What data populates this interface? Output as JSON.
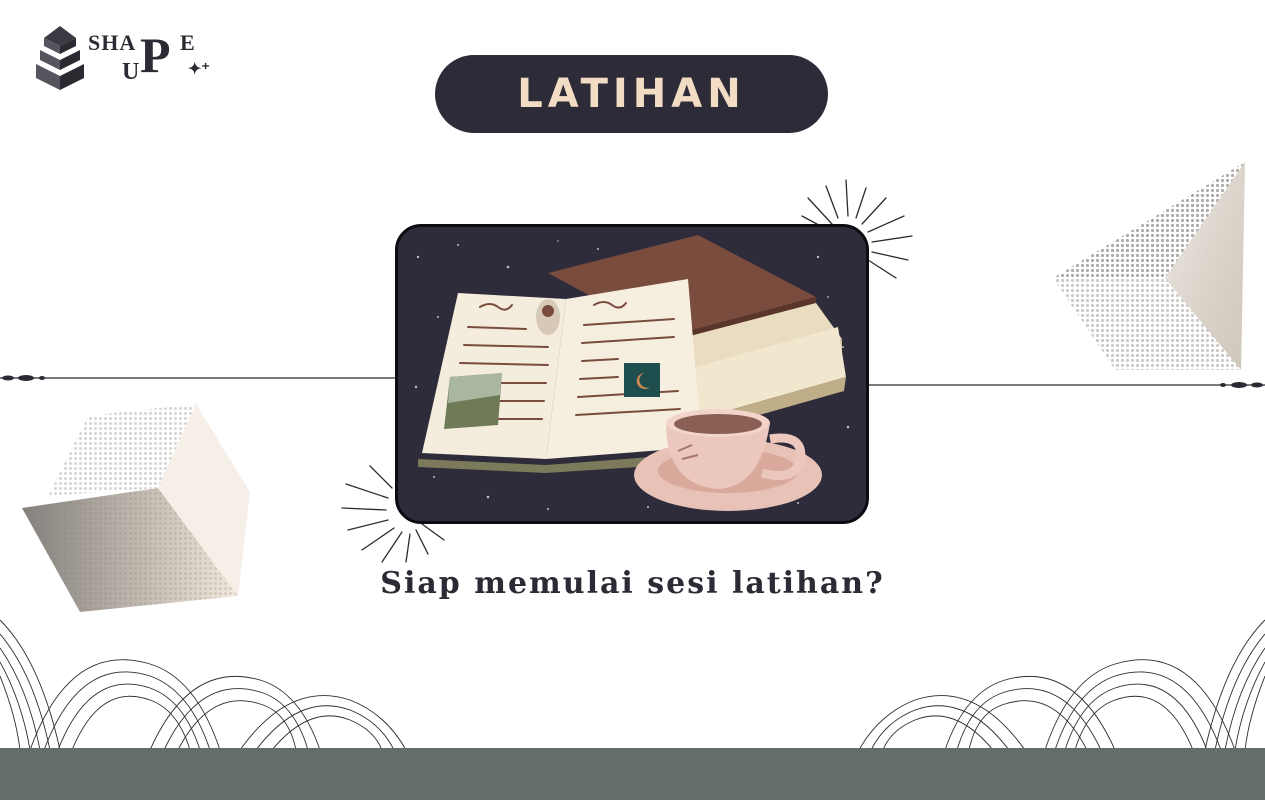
{
  "logo": {
    "line1": "SHA",
    "big_letter": "P",
    "letter_e": "E",
    "line2": "U",
    "sparkle": "✦⁺"
  },
  "header": {
    "title": "LATIHAN"
  },
  "main": {
    "image_icon": "books-and-coffee-illustration",
    "question": "Siap memulai sesi latihan?"
  },
  "colors": {
    "pill_bg": "#2d2b38",
    "title_text": "#f3dcc4",
    "card_bg": "#2e2b3a",
    "bottom_bar": "#636e68"
  }
}
